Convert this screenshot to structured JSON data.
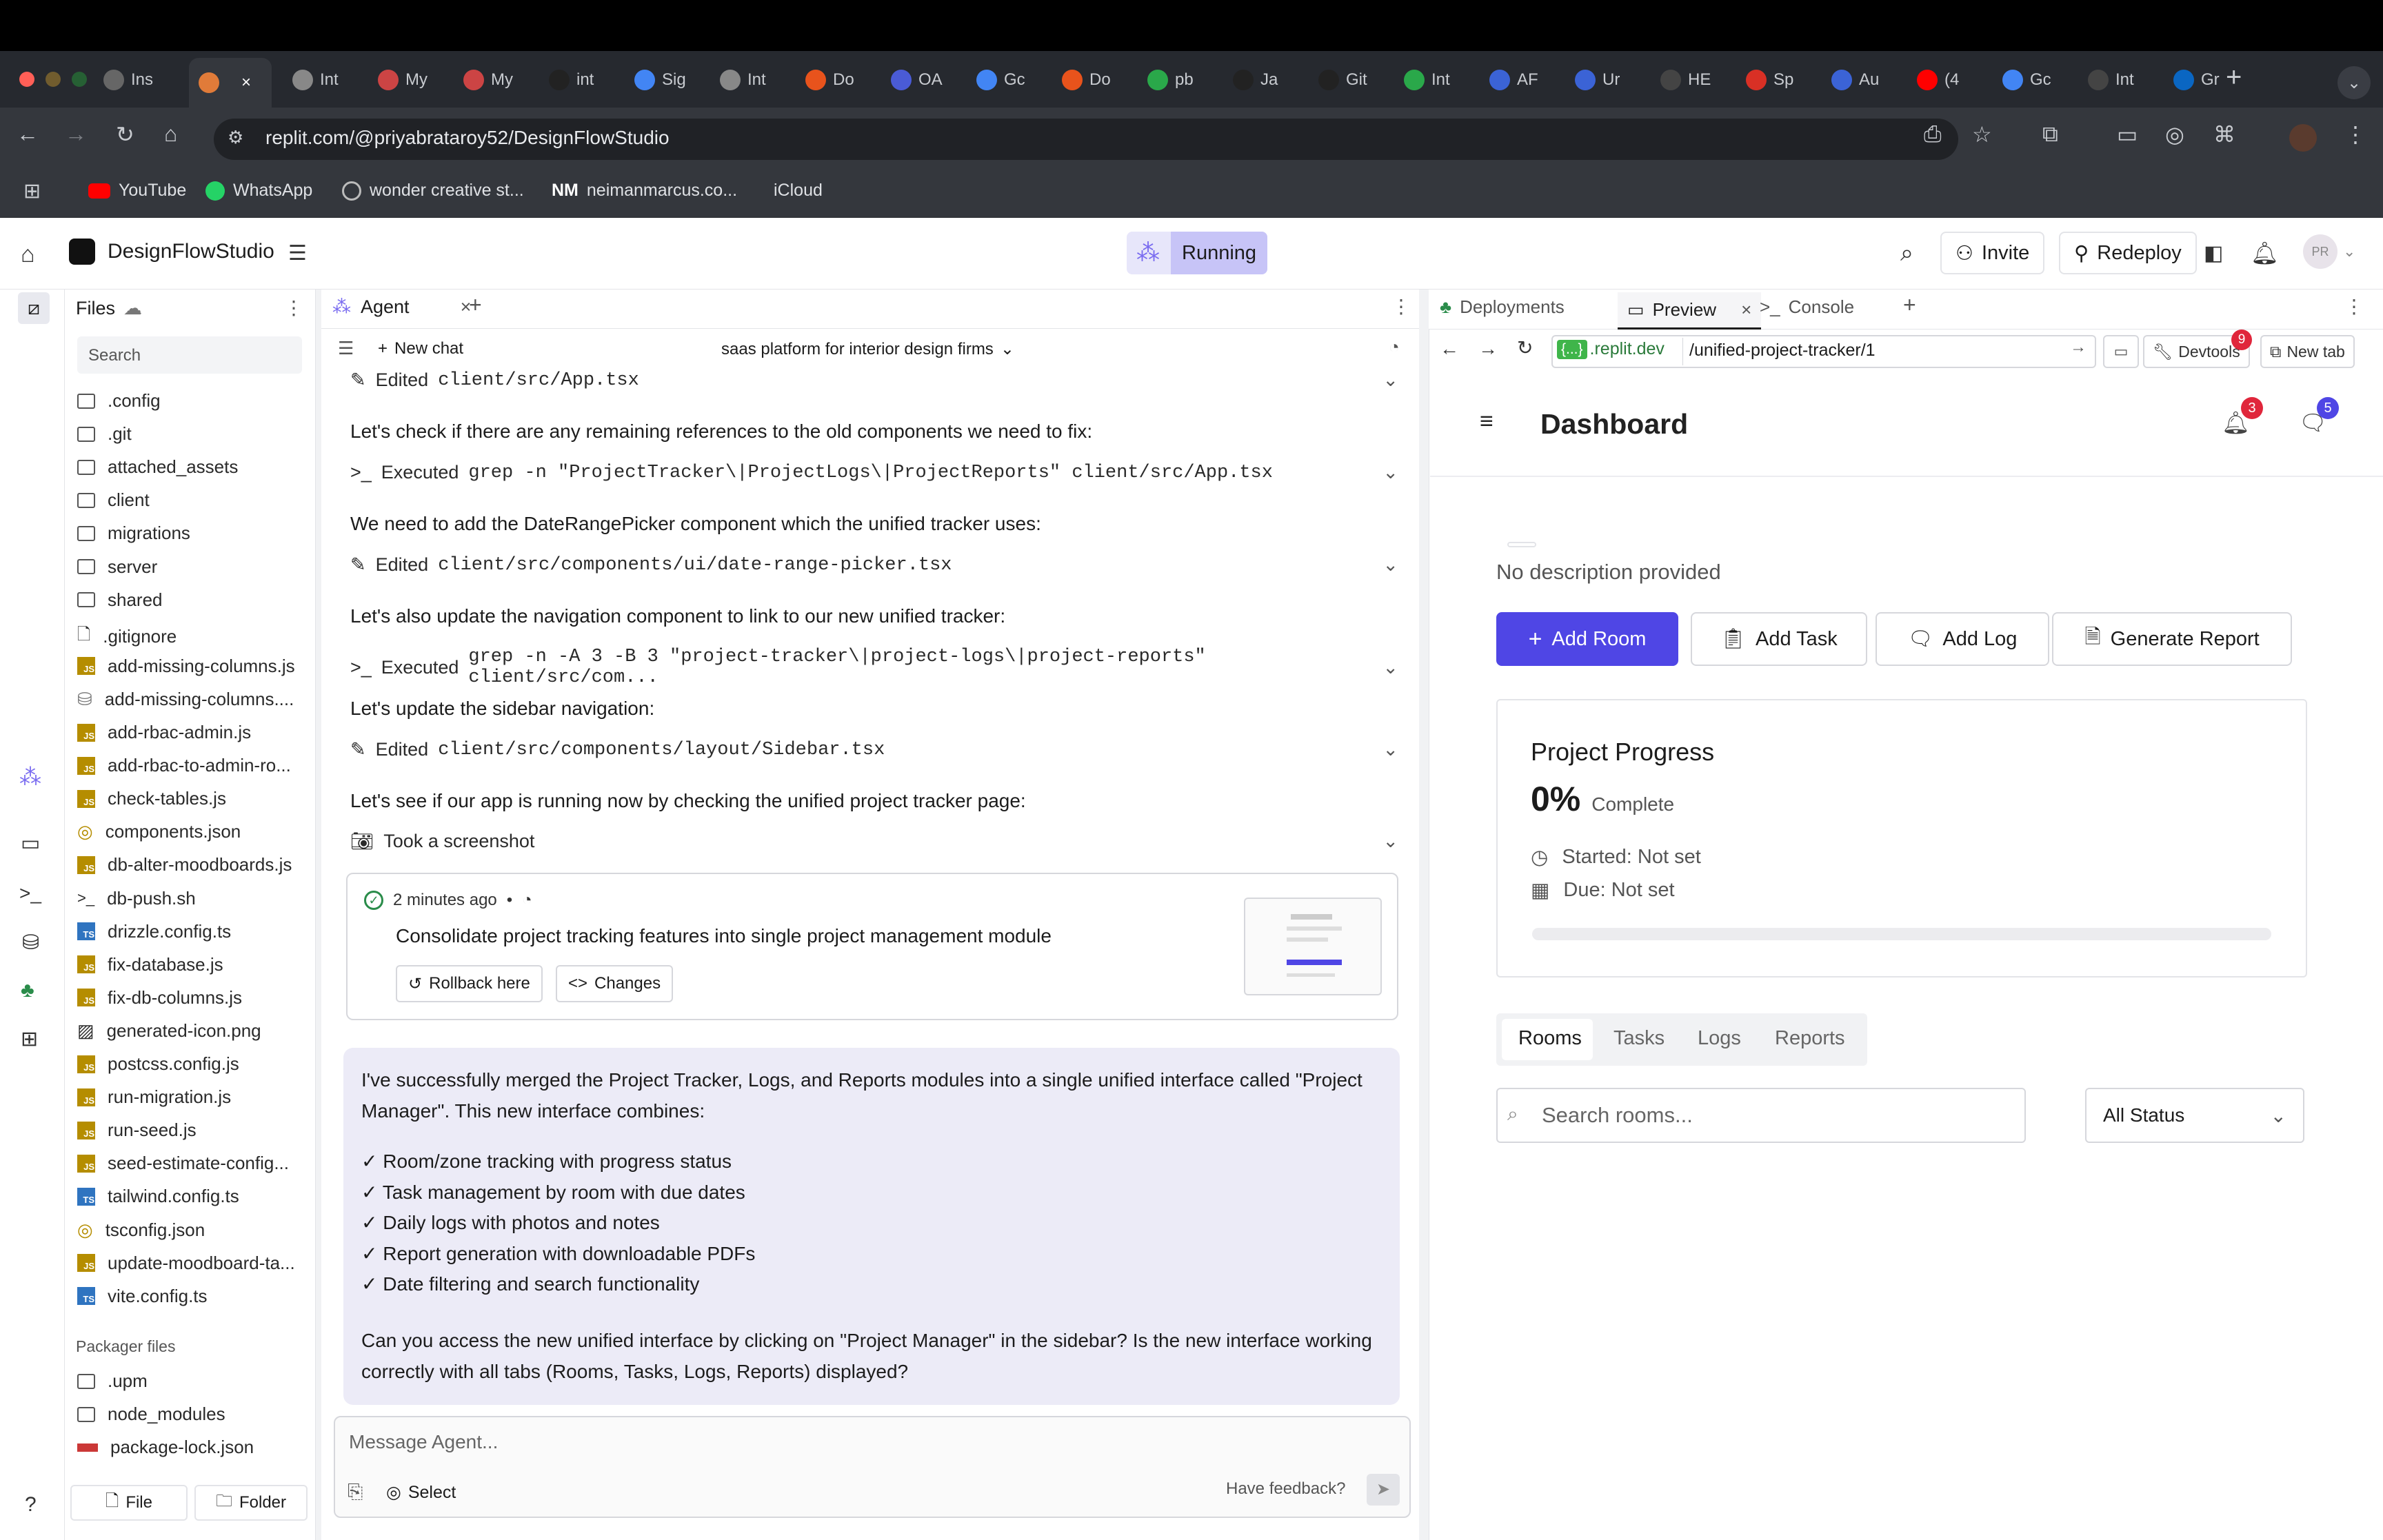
{
  "browser": {
    "tabs": [
      "Ins",
      "",
      "Int",
      "My",
      "My",
      "int",
      "Sig",
      "Int",
      "Do",
      "OA",
      "Gc",
      "Do",
      "pb",
      "Ja",
      "Git",
      "Int",
      "AF",
      "Ur",
      "HE",
      "Sp",
      "Au",
      "(4",
      "Gc",
      "Int",
      "Gr"
    ],
    "url": "replit.com/@priyabrataroy52/DesignFlowStudio",
    "bookmarks": [
      "YouTube",
      "WhatsApp",
      "wonder creative st...",
      "neimanmarcus.co...",
      "iCloud"
    ]
  },
  "topbar": {
    "project_name": "DesignFlowStudio",
    "status": "Running",
    "invite_label": "Invite",
    "redeploy_label": "Redeploy",
    "avatar_initials": "PR"
  },
  "files_panel": {
    "title": "Files",
    "search_placeholder": "Search",
    "items": [
      {
        "name": ".config",
        "type": "folder"
      },
      {
        "name": ".git",
        "type": "folder"
      },
      {
        "name": "attached_assets",
        "type": "folder"
      },
      {
        "name": "client",
        "type": "folder"
      },
      {
        "name": "migrations",
        "type": "folder"
      },
      {
        "name": "server",
        "type": "folder"
      },
      {
        "name": "shared",
        "type": "folder"
      },
      {
        "name": ".gitignore",
        "type": "file"
      },
      {
        "name": "add-missing-columns.js",
        "type": "js"
      },
      {
        "name": "add-missing-columns....",
        "type": "db"
      },
      {
        "name": "add-rbac-admin.js",
        "type": "js"
      },
      {
        "name": "add-rbac-to-admin-ro...",
        "type": "js"
      },
      {
        "name": "check-tables.js",
        "type": "js"
      },
      {
        "name": "components.json",
        "type": "json"
      },
      {
        "name": "db-alter-moodboards.js",
        "type": "js"
      },
      {
        "name": "db-push.sh",
        "type": "sh"
      },
      {
        "name": "drizzle.config.ts",
        "type": "ts"
      },
      {
        "name": "fix-database.js",
        "type": "js"
      },
      {
        "name": "fix-db-columns.js",
        "type": "js"
      },
      {
        "name": "generated-icon.png",
        "type": "img"
      },
      {
        "name": "postcss.config.js",
        "type": "js"
      },
      {
        "name": "run-migration.js",
        "type": "js"
      },
      {
        "name": "run-seed.js",
        "type": "js"
      },
      {
        "name": "seed-estimate-config...",
        "type": "js"
      },
      {
        "name": "tailwind.config.ts",
        "type": "ts"
      },
      {
        "name": "tsconfig.json",
        "type": "json"
      },
      {
        "name": "update-moodboard-ta...",
        "type": "js"
      },
      {
        "name": "vite.config.ts",
        "type": "ts"
      }
    ],
    "packager_title": "Packager files",
    "packager_items": [
      {
        "name": ".upm",
        "type": "folder"
      },
      {
        "name": "node_modules",
        "type": "folder"
      },
      {
        "name": "package-lock.json",
        "type": "npm"
      }
    ],
    "file_button": "File",
    "folder_button": "Folder"
  },
  "agent": {
    "tab_label": "Agent",
    "new_chat": "New chat",
    "chat_title": "saas platform for interior design firms",
    "entries": [
      {
        "kind": "action",
        "icon": "edit",
        "verb": "Edited",
        "code": "client/src/App.tsx"
      },
      {
        "kind": "text",
        "text": "Let's check if there are any remaining references to the old components we need to fix:"
      },
      {
        "kind": "action",
        "icon": "terminal",
        "verb": "Executed",
        "code": "grep -n \"ProjectTracker\\|ProjectLogs\\|ProjectReports\" client/src/App.tsx"
      },
      {
        "kind": "text",
        "text": "We need to add the DateRangePicker component which the unified tracker uses:"
      },
      {
        "kind": "action",
        "icon": "edit",
        "verb": "Edited",
        "code": "client/src/components/ui/date-range-picker.tsx"
      },
      {
        "kind": "text",
        "text": "Let's also update the navigation component to link to our new unified tracker:"
      },
      {
        "kind": "action",
        "icon": "terminal",
        "verb": "Executed",
        "code": "grep -n -A 3 -B 3 \"project-tracker\\|project-logs\\|project-reports\" client/src/com..."
      },
      {
        "kind": "text",
        "text": "Let's update the sidebar navigation:"
      },
      {
        "kind": "action",
        "icon": "edit",
        "verb": "Edited",
        "code": "client/src/components/layout/Sidebar.tsx"
      },
      {
        "kind": "text",
        "text": "Let's see if our app is running now by checking the unified project tracker page:"
      },
      {
        "kind": "action",
        "icon": "camera",
        "verb": "Took a screenshot",
        "code": ""
      }
    ],
    "checkpoint": {
      "time": "2 minutes ago",
      "message": "Consolidate project tracking features into single project management module",
      "rollback": "Rollback here",
      "changes": "Changes"
    },
    "summary": {
      "intro": "I've successfully merged the Project Tracker, Logs, and Reports modules into a single unified interface called \"Project Manager\". This new interface combines:",
      "bullets": [
        "✓ Room/zone tracking with progress status",
        "✓ Task management by room with due dates",
        "✓ Daily logs with photos and notes",
        "✓ Report generation with downloadable PDFs",
        "✓ Date filtering and search functionality"
      ],
      "question": "Can you access the new unified interface by clicking on \"Project Manager\" in the sidebar? Is the new interface working correctly with all tabs (Rooms, Tasks, Logs, Reports) displayed?"
    },
    "input_placeholder": "Message Agent...",
    "select_label": "Select",
    "feedback": "Have feedback?"
  },
  "preview_panel": {
    "tabs": [
      "Deployments",
      "Preview",
      "Console"
    ],
    "url_prefix": "{...}",
    "url_domain": ".replit.dev",
    "url_path": "/unified-project-tracker/1",
    "devtools_label": "Devtools",
    "devtools_badge": "9",
    "newtab_label": "New tab",
    "page": {
      "title": "Dashboard",
      "notif_badge": "3",
      "msg_badge": "5",
      "description": "No description provided",
      "buttons": [
        "Add Room",
        "Add Task",
        "Add Log",
        "Generate Report"
      ],
      "progress": {
        "title": "Project Progress",
        "value": "0%",
        "value_label": "Complete",
        "percent": 0,
        "started": "Started: Not set",
        "due": "Due: Not set"
      },
      "tabs": [
        "Rooms",
        "Tasks",
        "Logs",
        "Reports"
      ],
      "search_placeholder": "Search rooms...",
      "status_select": "All Status"
    }
  },
  "colors": {
    "accent": "#4f46e5",
    "running_bg": "#c7c4f7",
    "badge_red": "#e0263b",
    "summary_bg": "#ecebf7"
  }
}
